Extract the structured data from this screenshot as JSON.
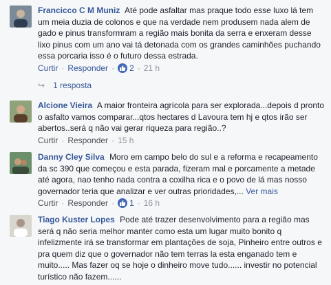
{
  "comments": [
    {
      "author": "Francicco C M Muniz",
      "text": "Até pode asfaltar mas praque todo esse luxo lá tem um meia duzia de colonos e que na verdade nem produsem nada alem de gado e pinus transformram a região mais bonita da serra e enxeram desse lixo pinus com um ano vai tá detonada com os grandes caminhões puchando essa porcaria isso é o futuro dessa estrada.",
      "like": "Curtir",
      "reply": "Responder",
      "likes": "2",
      "time": "21 h",
      "replies": "1 resposta"
    },
    {
      "author": "Alcione Vieira",
      "text": "A maior fronteira agrícola para ser explorada...depois d pronto o asfalto vamos comparar...qtos hectares d Lavoura tem hj e qtos irão ser abertos..será q não vai gerar riqueza para região..?",
      "like": "Curtir",
      "reply": "Responder",
      "time": "15 h"
    },
    {
      "author": "Danny Cley Silva",
      "text": "Moro em campo belo do sul e a reforma e recapeamento da sc 390 que começou e esta parada, fizeram mal e porcamente a metade até agora, nao tenho nada contra a coxilha rica e o povo de lá mas nosso governador teria que analizar e ver outras prioridades,...",
      "more": "Ver mais",
      "like": "Curtir",
      "reply": "Responder",
      "likes": "1",
      "time": "16 h"
    },
    {
      "author": "Tiago Kuster Lopes",
      "text": "Pode até trazer desenvolvimento para a região mas será q não seria melhor manter como esta um lugar muito bonito q infelizmente irá se transformar em plantações de soja, Pinheiro entre outros e pra quem diz que o governador não tem terras la esta enganado tem e muito..... Mas fazer oq se hoje o dinheiro move tudo...... investir no potencial turístico não fazem......"
    }
  ],
  "colors": {
    "author": "#365899",
    "text": "#1d2129",
    "meta": "#90949c",
    "like_badge": "#4267b2"
  }
}
